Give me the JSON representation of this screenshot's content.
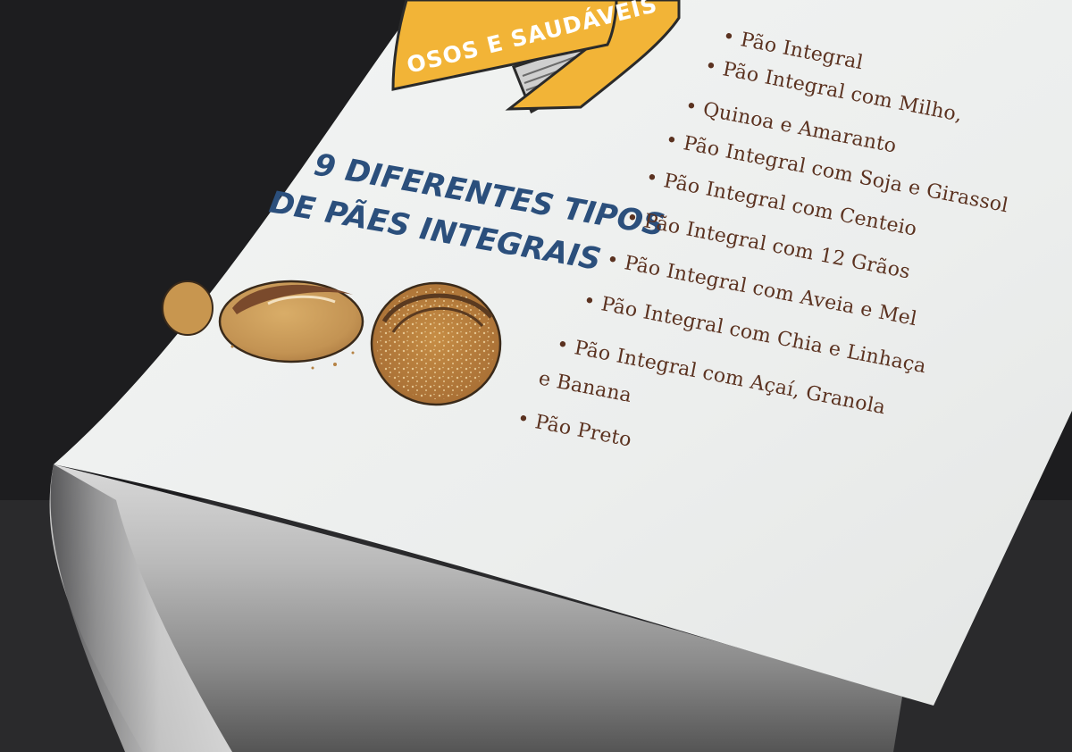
{
  "banner": {
    "text": "OSOS E SAUDÁVEIS"
  },
  "headline": {
    "line1": "9 DIFERENTES TIPOS",
    "line2": "DE PÃES INTEGRAIS"
  },
  "list": {
    "items": [
      "• Pão Integral",
      "• Pão Integral com Milho,",
      "• Quinoa e Amaranto",
      "• Pão Integral com Soja e Girassol",
      "• Pão Integral com Centeio",
      "• Pão Integral com 12 Grãos",
      "• Pão Integral com Aveia e Mel",
      "• Pão Integral com Chia e Linhaça",
      "• Pão Integral com Açaí, Granola",
      "e Banana",
      "• Pão Preto"
    ]
  },
  "colors": {
    "background": "#1d1d1f",
    "paper": "#eef0ef",
    "banner": "#f2b437",
    "headline": "#2b4f7c",
    "list_text": "#5b3220",
    "bread_light": "#c89a56",
    "bread_dark": "#7a4a2c"
  }
}
